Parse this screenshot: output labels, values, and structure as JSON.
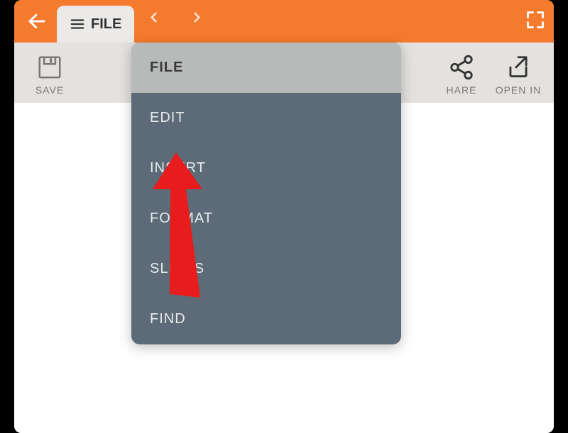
{
  "header": {
    "file_tab": "FILE"
  },
  "toolbar": {
    "save_label": "SAVE",
    "share_label": "HARE",
    "openin_label": "OPEN IN"
  },
  "menu": {
    "items": [
      {
        "label": "FILE",
        "selected": true
      },
      {
        "label": "EDIT",
        "selected": false
      },
      {
        "label": "INSERT",
        "selected": false
      },
      {
        "label": "FORMAT",
        "selected": false
      },
      {
        "label": "SLIDES",
        "selected": false
      },
      {
        "label": "FIND",
        "selected": false
      }
    ]
  },
  "annotation": {
    "points_to": "INSERT"
  }
}
